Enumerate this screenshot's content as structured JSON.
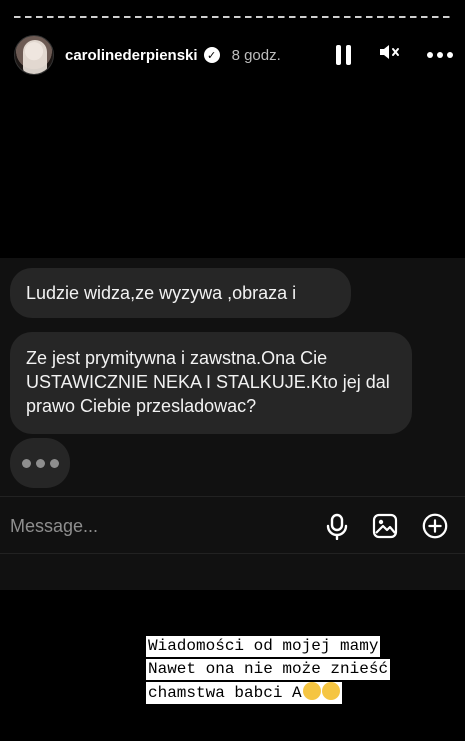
{
  "story": {
    "username": "carolinederpienski",
    "verified_icon": "check-badge-icon",
    "time": "8 godz.",
    "controls": [
      "pause-icon",
      "mute-icon",
      "more-icon"
    ]
  },
  "chat": {
    "messages": [
      "Ludzie widza,ze wyzywa ,obraza i",
      "Ze jest prymitywna i zawstna.Ona Cie USTAWICZNIE NEKA I STALKUJE.Kto jej dal prawo Ciebie przesladowac?"
    ],
    "typing_indicator": "typing-dots-icon",
    "input_placeholder": "Message...",
    "input_icons": [
      "microphone-icon",
      "image-icon",
      "plus-circle-icon"
    ]
  },
  "caption": {
    "lines": [
      "Wiadomości od mojej mamy",
      "Nawet ona nie może znieść",
      "chamstwa babci A"
    ]
  },
  "colors": {
    "background": "#000000",
    "chat_panel": "#111111",
    "bubble": "#262626",
    "caption_bg": "#ffffff"
  }
}
